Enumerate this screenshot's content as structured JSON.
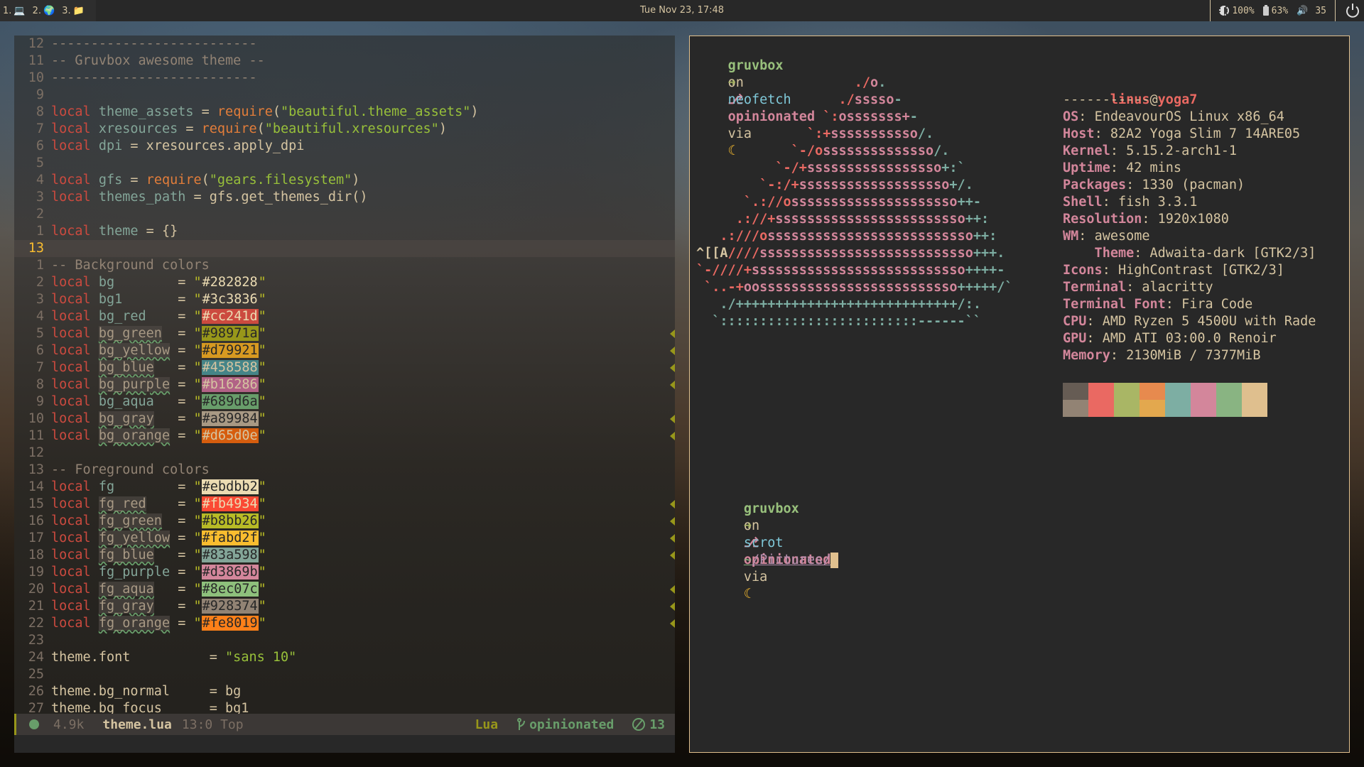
{
  "topbar": {
    "tags": [
      {
        "label": "1.",
        "icon": "laptop-icon",
        "glyph": "💻"
      },
      {
        "label": "2.",
        "icon": "globe-icon",
        "glyph": "🌍"
      },
      {
        "label": "3.",
        "icon": "folder-icon",
        "glyph": "📁"
      }
    ],
    "clock": "Tue Nov 23, 17:48",
    "brightness": "100%",
    "battery": "63%",
    "volume": "35"
  },
  "editor": {
    "lines": [
      {
        "n": "12",
        "parts": [
          [
            "cm",
            "--------------------------"
          ]
        ]
      },
      {
        "n": "11",
        "parts": [
          [
            "cm",
            "-- Gruvbox awesome theme --"
          ]
        ]
      },
      {
        "n": "10",
        "parts": [
          [
            "cm",
            "--------------------------"
          ]
        ]
      },
      {
        "n": "9",
        "parts": []
      },
      {
        "n": "8",
        "parts": [
          [
            "kw",
            "local"
          ],
          [
            "op",
            " "
          ],
          [
            "id",
            "theme_assets"
          ],
          [
            "op",
            " = "
          ],
          [
            "fn",
            "require"
          ],
          [
            "op",
            "("
          ],
          [
            "str",
            "\"beautiful.theme_assets\""
          ],
          [
            "op",
            ")"
          ]
        ]
      },
      {
        "n": "7",
        "parts": [
          [
            "kw",
            "local"
          ],
          [
            "op",
            " "
          ],
          [
            "id",
            "xresources"
          ],
          [
            "op",
            " = "
          ],
          [
            "fn",
            "require"
          ],
          [
            "op",
            "("
          ],
          [
            "str",
            "\"beautiful.xresources\""
          ],
          [
            "op",
            ")"
          ]
        ]
      },
      {
        "n": "6",
        "parts": [
          [
            "kw",
            "local"
          ],
          [
            "op",
            " "
          ],
          [
            "id",
            "dpi"
          ],
          [
            "op",
            " = xresources.apply_dpi"
          ]
        ]
      },
      {
        "n": "5",
        "parts": []
      },
      {
        "n": "4",
        "parts": [
          [
            "kw",
            "local"
          ],
          [
            "op",
            " "
          ],
          [
            "id",
            "gfs"
          ],
          [
            "op",
            " = "
          ],
          [
            "fn",
            "require"
          ],
          [
            "op",
            "("
          ],
          [
            "str",
            "\"gears.filesystem\""
          ],
          [
            "op",
            ")"
          ]
        ]
      },
      {
        "n": "3",
        "parts": [
          [
            "kw",
            "local"
          ],
          [
            "op",
            " "
          ],
          [
            "id",
            "themes_path"
          ],
          [
            "op",
            " = gfs.get_themes_dir()"
          ]
        ]
      },
      {
        "n": "2",
        "parts": []
      },
      {
        "n": "1",
        "parts": [
          [
            "kw",
            "local"
          ],
          [
            "op",
            " "
          ],
          [
            "id",
            "theme"
          ],
          [
            "op",
            " = {}"
          ]
        ]
      },
      {
        "n": "13",
        "parts": [],
        "current": true
      },
      {
        "n": "1",
        "parts": [
          [
            "cm",
            "-- Background colors"
          ]
        ]
      },
      {
        "n": "2",
        "var": "bg",
        "pad": "        ",
        "hex": "#282828",
        "swatch": "",
        "fg": "#ebdbb2"
      },
      {
        "n": "3",
        "var": "bg1",
        "pad": "       ",
        "hex": "#3c3836",
        "swatch": "#3c3836",
        "fg": "#ebdbb2"
      },
      {
        "n": "4",
        "var": "bg_red",
        "pad": "    ",
        "hex": "#cc241d",
        "swatch": "#cc4a3f",
        "fg": "#ebdbb2"
      },
      {
        "n": "5",
        "var": "bg_green",
        "pad": "  ",
        "hex": "#98971a",
        "swatch": "#98971a",
        "fg": "#282828",
        "warn": true,
        "sign": true
      },
      {
        "n": "6",
        "var": "bg_yellow",
        "pad": " ",
        "hex": "#d79921",
        "swatch": "#d79921",
        "fg": "#282828",
        "warn": true,
        "sign": true
      },
      {
        "n": "7",
        "var": "bg_blue",
        "pad": "   ",
        "hex": "#458588",
        "swatch": "#458588",
        "fg": "#d5c4a1",
        "warn": true,
        "sign": true
      },
      {
        "n": "8",
        "var": "bg_purple",
        "pad": " ",
        "hex": "#b16286",
        "swatch": "#b16286",
        "fg": "#d5c4a1",
        "warn": true,
        "sign": true
      },
      {
        "n": "9",
        "var": "bg_aqua",
        "pad": "   ",
        "hex": "#689d6a",
        "swatch": "#689d6a",
        "fg": "#282828"
      },
      {
        "n": "10",
        "var": "bg_gray",
        "pad": "   ",
        "hex": "#a89984",
        "swatch": "#a89984",
        "fg": "#282828",
        "warn": true,
        "sign": true
      },
      {
        "n": "11",
        "var": "bg_orange",
        "pad": " ",
        "hex": "#d65d0e",
        "swatch": "#d65d0e",
        "fg": "#d5c4a1",
        "warn": true,
        "sign": true
      },
      {
        "n": "12",
        "parts": []
      },
      {
        "n": "13",
        "parts": [
          [
            "cm",
            "-- Foreground colors"
          ]
        ]
      },
      {
        "n": "14",
        "var": "fg",
        "pad": "        ",
        "hex": "#ebdbb2",
        "swatch": "#ebdbb2",
        "fg": "#282828"
      },
      {
        "n": "15",
        "var": "fg_red",
        "pad": "    ",
        "hex": "#fb4934",
        "swatch": "#fb4934",
        "fg": "#ebdbb2",
        "warn": true,
        "sign": true
      },
      {
        "n": "16",
        "var": "fg_green",
        "pad": "  ",
        "hex": "#b8bb26",
        "swatch": "#b8bb26",
        "fg": "#282828",
        "warn": true,
        "sign": true
      },
      {
        "n": "17",
        "var": "fg_yellow",
        "pad": " ",
        "hex": "#fabd2f",
        "swatch": "#fabd2f",
        "fg": "#282828",
        "warn": true,
        "sign": true
      },
      {
        "n": "18",
        "var": "fg_blue",
        "pad": "   ",
        "hex": "#83a598",
        "swatch": "#83a598",
        "fg": "#282828",
        "warn": true,
        "sign": true
      },
      {
        "n": "19",
        "var": "fg_purple",
        "pad": " ",
        "hex": "#d3869b",
        "swatch": "#d3869b",
        "fg": "#282828"
      },
      {
        "n": "20",
        "var": "fg_aqua",
        "pad": "   ",
        "hex": "#8ec07c",
        "swatch": "#8ec07c",
        "fg": "#282828",
        "warn": true,
        "sign": true
      },
      {
        "n": "21",
        "var": "fg_gray",
        "pad": "   ",
        "hex": "#928374",
        "swatch": "#928374",
        "fg": "#282828",
        "warn": true,
        "sign": true
      },
      {
        "n": "22",
        "var": "fg_orange",
        "pad": " ",
        "hex": "#fe8019",
        "swatch": "#fe8019",
        "fg": "#282828",
        "warn": true,
        "sign": true
      },
      {
        "n": "23",
        "parts": []
      },
      {
        "n": "24",
        "parts": [
          [
            "op",
            "theme.font          = "
          ],
          [
            "str",
            "\"sans 10\""
          ]
        ]
      },
      {
        "n": "25",
        "parts": []
      },
      {
        "n": "26",
        "parts": [
          [
            "op",
            "theme.bg_normal     = bg"
          ]
        ]
      },
      {
        "n": "27",
        "parts": [
          [
            "op",
            "theme.bg_focus      = bg1"
          ]
        ]
      }
    ],
    "statusline": {
      "size": "4.9k",
      "file": "theme.lua",
      "position": "13:0 Top",
      "language": "Lua",
      "branch": "opinionated",
      "diagnostics": "13"
    }
  },
  "terminal": {
    "prompt1": {
      "dir": "gruvbox",
      "on": "on",
      "branch": "opinionated",
      "via": "via",
      "arrow": "➜",
      "command": "neofetch"
    },
    "ascii": [
      [
        [
          "c-red",
          "                    ./"
        ],
        [
          "c-pink",
          "o"
        ],
        [
          "c-aqua",
          "."
        ]
      ],
      [
        [
          "c-red",
          "                  ./"
        ],
        [
          "c-pink",
          "sssso"
        ],
        [
          "c-aqua",
          "-"
        ]
      ],
      [
        [
          "c-red",
          "                `:"
        ],
        [
          "c-pink",
          "osssssss+"
        ],
        [
          "c-aqua",
          "-"
        ]
      ],
      [
        [
          "c-red",
          "              `:+"
        ],
        [
          "c-pink",
          "sssssssssso"
        ],
        [
          "c-aqua",
          "/."
        ]
      ],
      [
        [
          "c-red",
          "            `-/o"
        ],
        [
          "c-pink",
          "ssssssssssssso"
        ],
        [
          "c-aqua",
          "/."
        ]
      ],
      [
        [
          "c-red",
          "          `-/+"
        ],
        [
          "c-pink",
          "sssssssssssssssso"
        ],
        [
          "c-aqua",
          "+:`"
        ]
      ],
      [
        [
          "c-red",
          "        `-:/+"
        ],
        [
          "c-pink",
          "sssssssssssssssssso"
        ],
        [
          "c-aqua",
          "+/."
        ]
      ],
      [
        [
          "c-red",
          "      `.://o"
        ],
        [
          "c-pink",
          "sssssssssssssssssssso"
        ],
        [
          "c-aqua",
          "++-"
        ]
      ],
      [
        [
          "c-red",
          "     .://+"
        ],
        [
          "c-pink",
          "ssssssssssssssssssssssso"
        ],
        [
          "c-aqua",
          "++:"
        ]
      ],
      [
        [
          "c-red",
          "   .:///o"
        ],
        [
          "c-pink",
          "ssssssssssssssssssssssssso"
        ],
        [
          "c-aqua",
          "++:"
        ]
      ],
      [
        [
          "c-tan",
          "^[[A"
        ],
        [
          "c-red",
          "////"
        ],
        [
          "c-pink",
          "sssssssssssssssssssssssssso"
        ],
        [
          "c-aqua",
          "+++."
        ]
      ],
      [
        [
          "c-red",
          "`-////+"
        ],
        [
          "c-pink",
          "sssssssssssssssssssssssssso"
        ],
        [
          "c-aqua",
          "++++-"
        ]
      ],
      [
        [
          "c-red",
          " `..-+"
        ],
        [
          "c-pink",
          "oosssssssssssssssssssssssso"
        ],
        [
          "c-aqua",
          "+++++/`"
        ]
      ],
      [
        [
          "c-aqua",
          "   ./++++++++++++++++++++++++++++/:."
        ]
      ],
      [
        [
          "c-aqua",
          "  `:::::::::::::::::::::::::------``"
        ]
      ]
    ],
    "info": {
      "user": "linus",
      "at": "@",
      "host": "yoga7",
      "separator": "-----------",
      "fields": [
        {
          "key": "OS",
          "value": "EndeavourOS Linux x86_64"
        },
        {
          "key": "Host",
          "value": "82A2 Yoga Slim 7 14ARE05"
        },
        {
          "key": "Kernel",
          "value": "5.15.2-arch1-1"
        },
        {
          "key": "Uptime",
          "value": "42 mins"
        },
        {
          "key": "Packages",
          "value": "1330 (pacman)"
        },
        {
          "key": "Shell",
          "value": "fish 3.3.1"
        },
        {
          "key": "Resolution",
          "value": "1920x1080"
        },
        {
          "key": "WM",
          "value": "awesome"
        },
        {
          "key": "    Theme",
          "value": "Adwaita-dark [GTK2/3]"
        },
        {
          "key": "Icons",
          "value": "HighContrast [GTK2/3]"
        },
        {
          "key": "Terminal",
          "value": "alacritty"
        },
        {
          "key": "Terminal Font",
          "value": "Fira Code"
        },
        {
          "key": "CPU",
          "value": "AMD Ryzen 5 4500U with Rade"
        },
        {
          "key": "GPU",
          "value": "AMD ATI 03:00.0 Renoir"
        },
        {
          "key": "Memory",
          "value": "2130MiB / 7377MiB"
        }
      ]
    },
    "palette": {
      "top": [
        "#665c54",
        "#ea6962",
        "#a9b665",
        "#e78a4e",
        "#7daea3",
        "#d3869b",
        "#89b482",
        "#dfbf8e"
      ],
      "bottom": [
        "#928374",
        "#ea6962",
        "#a9b665",
        "#e3a84e",
        "#7daea3",
        "#d3869b",
        "#89b482",
        "#dfbf8e"
      ]
    },
    "prompt2": {
      "dir": "gruvbox",
      "on": "on",
      "branch": "opinionated",
      "via": "via",
      "arrow": "➜",
      "command": "scrot",
      "arg_tilde": "~",
      "arg_path": "/Pictures/"
    }
  }
}
